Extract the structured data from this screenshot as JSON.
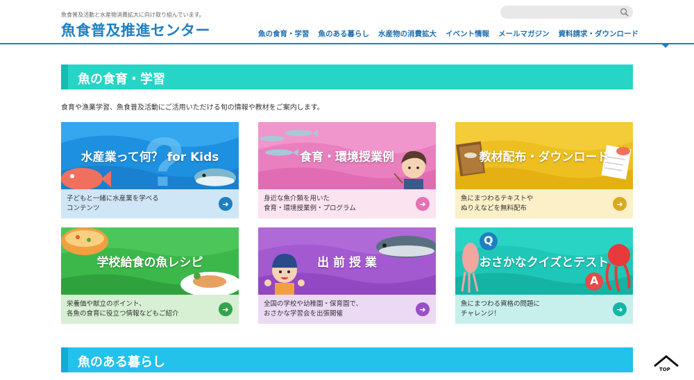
{
  "header": {
    "tagline": "魚食普及活動と水産物消費拡大に向け取り組んでいます。",
    "logo": "魚食普及推進センター",
    "search_placeholder": "",
    "nav": [
      "魚の食育・学習",
      "魚のある暮らし",
      "水産物の消費拡大",
      "イベント情報",
      "メールマガジン",
      "資料請求・ダウンロード"
    ]
  },
  "section1": {
    "title": "魚の食育・学習",
    "intro": "食育や漁業学習、魚食普及活動にご活用いただける旬の情報や教材をご案内します。"
  },
  "cards": [
    {
      "title": "水産業って何？ for Kids",
      "desc": "子どもと一緒に水産業を学べる\nコンテンツ",
      "banner_color": "#1e90e0",
      "desc_bg": "#cfe6f7",
      "button_color": "#1e7fc2"
    },
    {
      "title": "食育・環境授業例",
      "desc": "身近な魚介類を用いた\n食育・環境授業例・プログラム",
      "banner_color": "#ea7fc0",
      "desc_bg": "#fbe3f0",
      "button_color": "#e472b4"
    },
    {
      "title": "教材配布・ダウンロード",
      "desc": "魚にまつわるテキストや\nぬりえなどを無料配布",
      "banner_color": "#eebf20",
      "desc_bg": "#fbf0c8",
      "button_color": "#d9aa20"
    },
    {
      "title": "学校給食の魚レシピ",
      "desc": "栄養価や献立のポイント、\n各魚の食育に役立つ情報などもご紹介",
      "banner_color": "#3cb84a",
      "desc_bg": "#d7efd3",
      "button_color": "#33a24a"
    },
    {
      "title": "出 前 授 業",
      "desc": "全国の学校や幼稚園・保育園で、\nおさかな学習会を出張開催",
      "banner_color": "#a35ad0",
      "desc_bg": "#ecdaf5",
      "button_color": "#9a4fca"
    },
    {
      "title": "おさかなクイズとテスト",
      "desc": "魚にまつわる資格の問題に\nチャレンジ！",
      "banner_color": "#1fc7b8",
      "desc_bg": "#c7f0ec",
      "button_color": "#19b3a6"
    }
  ],
  "section2": {
    "title": "魚のある暮らし"
  },
  "top_button": "TOP",
  "quiz_letters": {
    "q": "Q",
    "a": "A"
  }
}
